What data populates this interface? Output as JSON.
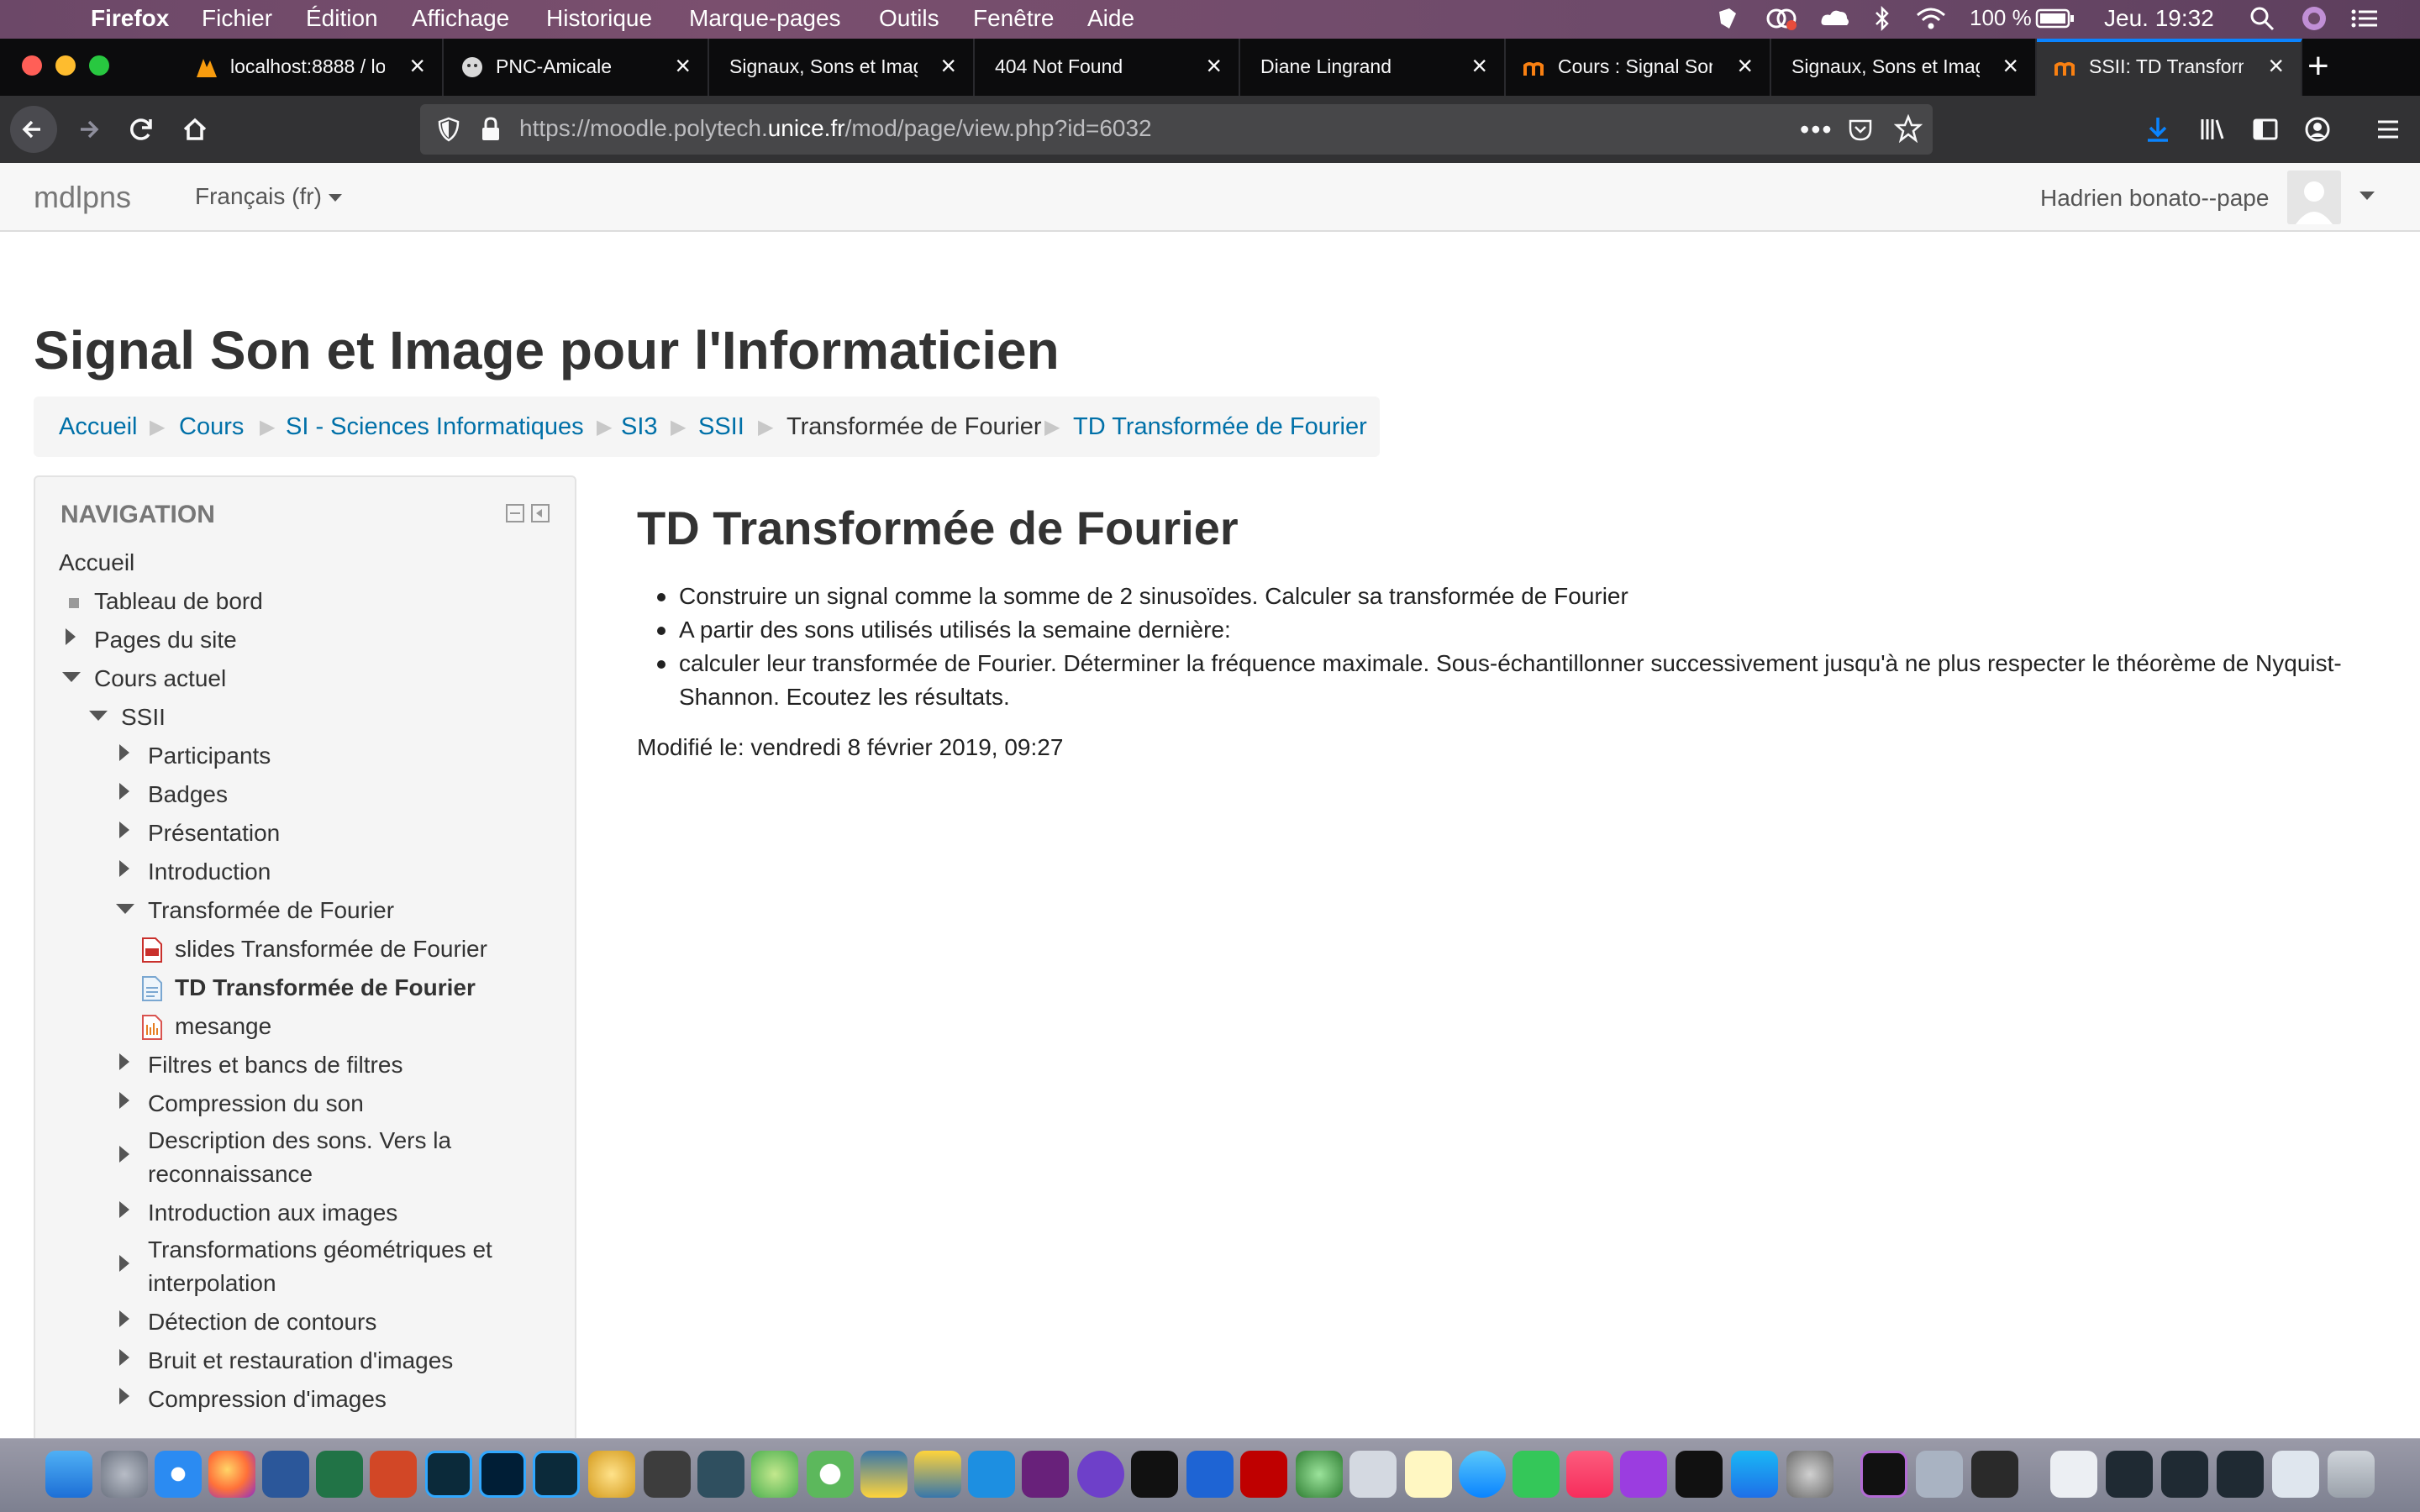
{
  "menubar": {
    "app": "Firefox",
    "items": [
      "Fichier",
      "Édition",
      "Affichage",
      "Historique",
      "Marque-pages",
      "Outils",
      "Fenêtre",
      "Aide"
    ],
    "battery": "100 %",
    "clock": "Jeu. 19:32"
  },
  "tabs": [
    {
      "title": "localhost:8888 / lo"
    },
    {
      "title": "PNC-Amicale"
    },
    {
      "title": "Signaux, Sons et Image"
    },
    {
      "title": "404 Not Found"
    },
    {
      "title": "Diane Lingrand"
    },
    {
      "title": "Cours : Signal Son"
    },
    {
      "title": "Signaux, Sons et Image"
    },
    {
      "title": "SSII: TD Transform",
      "active": true
    }
  ],
  "toolbar": {
    "url_prefix": "https://moodle.polytech.",
    "url_domain": "unice.fr",
    "url_path": "/mod/page/view.php?id=6032"
  },
  "moodle": {
    "brand": "mdlpns",
    "language": "Français (fr)",
    "user": "Hadrien bonato--pape"
  },
  "page": {
    "title": "Signal Son et Image pour l'Informaticien",
    "breadcrumb": [
      "Accueil",
      "Cours",
      "SI - Sciences Informatiques",
      "SI3",
      "SSII",
      "Transformée de Fourier",
      "TD Transformée de Fourier"
    ]
  },
  "navigation": {
    "heading": "NAVIGATION",
    "home": "Accueil",
    "dashboard": "Tableau de bord",
    "site_pages": "Pages du site",
    "current_course": "Cours actuel",
    "course": "SSII",
    "sections": [
      "Participants",
      "Badges",
      "Présentation",
      "Introduction",
      "Transformée de Fourier"
    ],
    "resources": [
      "slides Transformée de Fourier",
      "TD Transformée de Fourier",
      "mesange"
    ],
    "more_sections": [
      "Filtres et bancs de filtres",
      "Compression du son",
      "Description des sons. Vers la",
      "reconnaissance",
      "Introduction aux images",
      "Transformations géométriques et",
      "interpolation",
      "Détection de contours",
      "Bruit et restauration d'images",
      "Compression d'images"
    ]
  },
  "main": {
    "title": "TD Transformée de Fourier",
    "items": [
      "Construire un signal comme la somme de 2 sinusoïdes. Calculer sa transformée de Fourier",
      "A partir des sons utilisés utilisés la semaine dernière:",
      "calculer leur transformée de Fourier. Déterminer la fréquence maximale. Sous-échantillonner successivement jusqu'à ne plus respecter le théorème de Nyquist-Shannon. Ecoutez les résultats."
    ],
    "modified": "Modifié le: vendredi 8 février 2019, 09:27"
  },
  "colors": {
    "link": "#0070a8",
    "firefox_dark": "#0c0c0d",
    "active_tab_accent": "#0a84ff"
  }
}
